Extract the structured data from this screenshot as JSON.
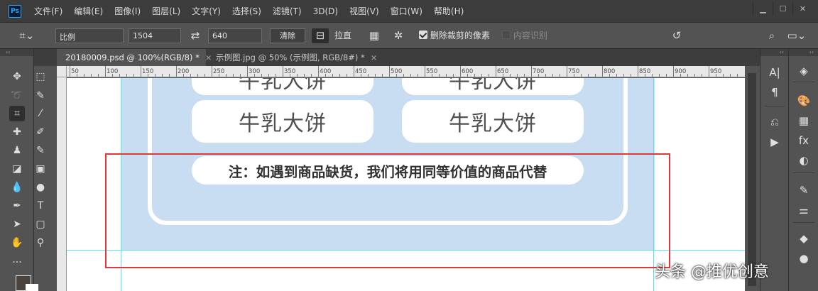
{
  "menu": {
    "logo": "Ps",
    "items": [
      "文件(F)",
      "编辑(E)",
      "图像(I)",
      "图层(L)",
      "文字(Y)",
      "选择(S)",
      "滤镜(T)",
      "3D(D)",
      "视图(V)",
      "窗口(W)",
      "帮助(H)"
    ]
  },
  "options": {
    "ratio_select": "比例",
    "width_value": "1504",
    "height_value": "640",
    "clear_label": "清除",
    "straighten_label": "拉直",
    "delete_cropped_label": "删除裁剪的像素",
    "delete_cropped_checked": true,
    "content_aware_label": "内容识别",
    "content_aware_checked": false
  },
  "tabs": [
    {
      "label": "20180009.psd @ 100%(RGB/8) *",
      "close": "×",
      "active": true
    },
    {
      "label": "示例图.jpg @ 50% (示例图, RGB/8#) *",
      "close": "×",
      "active": false
    }
  ],
  "ruler": {
    "labels": [
      "50",
      "100",
      "150",
      "200",
      "250",
      "300",
      "350",
      "400",
      "450",
      "500",
      "550",
      "600",
      "650",
      "700",
      "750",
      "800",
      "850",
      "900",
      "950"
    ]
  },
  "canvas": {
    "pills_top": [
      "牛乳大饼",
      "牛乳大饼"
    ],
    "pills": [
      "牛乳大饼",
      "牛乳大饼"
    ],
    "note": "注：如遇到商品缺货，我们将用同等价值的商品代替",
    "colors": {
      "panel_blue": "#c9ddf2",
      "highlight_red": "#e0383b",
      "guide_cyan": "#5ee0e8"
    }
  },
  "watermark": "头条 @推优创意"
}
